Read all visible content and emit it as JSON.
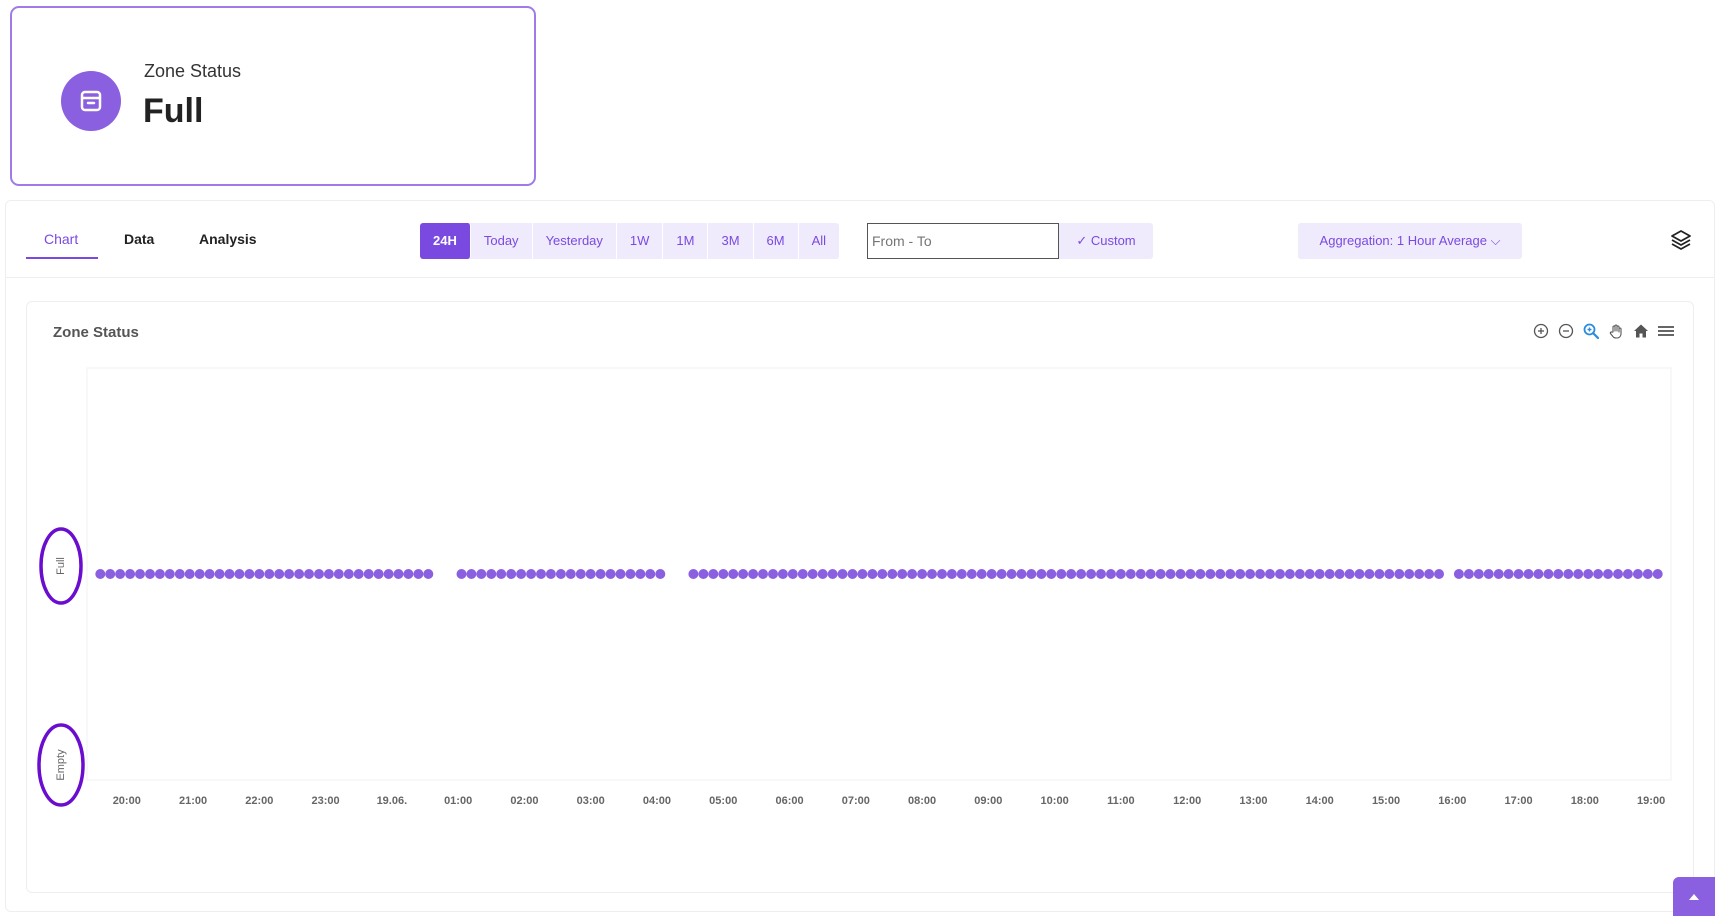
{
  "status_card": {
    "label": "Zone Status",
    "value": "Full",
    "icon": "archive-box-icon"
  },
  "tabs": [
    {
      "label": "Chart",
      "active": true
    },
    {
      "label": "Data",
      "active": false
    },
    {
      "label": "Analysis",
      "active": false
    }
  ],
  "ranges": [
    "24H",
    "Today",
    "Yesterday",
    "1W",
    "1M",
    "3M",
    "6M",
    "All"
  ],
  "active_range": "24H",
  "date_range": {
    "placeholder": "From - To"
  },
  "custom_label": "✓ Custom",
  "aggregation_label": "Aggregation: 1 Hour Average ⌵",
  "accent_color": "#7a4ae0",
  "chart_data": {
    "type": "scatter",
    "title": "Zone Status",
    "y_categories": [
      "Empty",
      "Full"
    ],
    "x_tick_labels": [
      "20:00",
      "21:00",
      "22:00",
      "23:00",
      "19.06.",
      "01:00",
      "02:00",
      "03:00",
      "04:00",
      "05:00",
      "06:00",
      "07:00",
      "08:00",
      "09:00",
      "10:00",
      "11:00",
      "12:00",
      "13:00",
      "14:00",
      "15:00",
      "16:00",
      "17:00",
      "18:00",
      "19:00"
    ],
    "series": [
      {
        "value": "Full",
        "segments": [
          [
            19.6,
            24.55
          ],
          [
            25.05,
            28.05
          ],
          [
            28.55,
            39.85
          ],
          [
            40.1,
            43.2
          ]
        ]
      }
    ],
    "xlim": [
      19.4,
      43.3
    ],
    "color": "#8a5fe0",
    "grid": false
  }
}
